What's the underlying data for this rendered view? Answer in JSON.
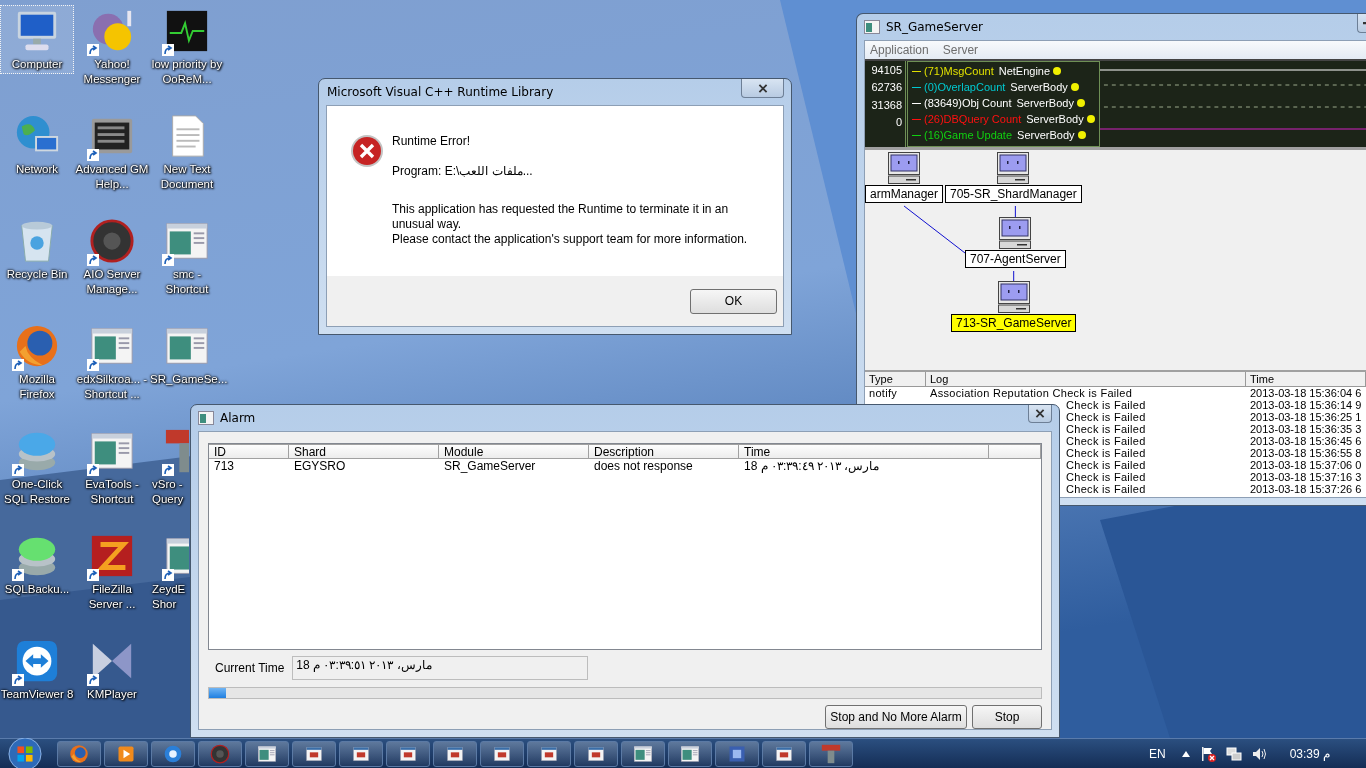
{
  "desktop": {
    "icons": [
      {
        "label": "Computer",
        "kind": "computer",
        "shortcut": false,
        "selected": true
      },
      {
        "label": "Yahoo! Messenger",
        "kind": "messenger",
        "shortcut": true,
        "selected": false
      },
      {
        "label": "low priority by OoReM...",
        "kind": "monitor",
        "shortcut": true,
        "selected": false
      },
      {
        "label": "Network",
        "kind": "network",
        "shortcut": false,
        "selected": false
      },
      {
        "label": "Advanced GM Help...",
        "kind": "terminal",
        "shortcut": true,
        "selected": false
      },
      {
        "label": "New Text Document",
        "kind": "document",
        "shortcut": false,
        "selected": false
      },
      {
        "label": "Recycle Bin",
        "kind": "recycle",
        "shortcut": false,
        "selected": false
      },
      {
        "label": "AIO Server Manage...",
        "kind": "disc",
        "shortcut": true,
        "selected": false
      },
      {
        "label": "smc - Shortcut",
        "kind": "app-window",
        "shortcut": true,
        "selected": false
      },
      {
        "label": "Mozilla Firefox",
        "kind": "browser",
        "shortcut": true,
        "selected": false
      },
      {
        "label": "edxSilkroa... - Shortcut ...",
        "kind": "app-window",
        "shortcut": true,
        "selected": false
      },
      {
        "label": "SR_GameSe...",
        "kind": "app-window",
        "shortcut": false,
        "selected": false
      },
      {
        "label": "One-Click SQL Restore",
        "kind": "database",
        "shortcut": true,
        "selected": false
      },
      {
        "label": "EvaTools - Shortcut",
        "kind": "app-window",
        "shortcut": true,
        "selected": false
      },
      {
        "label": "vSro - Query",
        "kind": "tool",
        "shortcut": true,
        "selected": false
      },
      {
        "label": "SQLBacku...",
        "kind": "backup",
        "shortcut": true,
        "selected": false
      },
      {
        "label": "FileZilla Server ...",
        "kind": "filezilla",
        "shortcut": true,
        "selected": false
      },
      {
        "label": "ZeydE Shor",
        "kind": "app-window",
        "shortcut": true,
        "selected": false
      },
      {
        "label": "TeamViewer 8",
        "kind": "teamviewer",
        "shortcut": true,
        "selected": false
      },
      {
        "label": "KMPlayer",
        "kind": "player",
        "shortcut": true,
        "selected": false
      }
    ]
  },
  "runtime_dialog": {
    "title": "Microsoft Visual C++ Runtime Library",
    "heading": "Runtime Error!",
    "program": "Program: E:\\ملفات اللعب...",
    "message": "This application has requested the Runtime to terminate it in an unusual way.",
    "message_2": "Please contact the application's support team for more information.",
    "button": "OK"
  },
  "sr_window": {
    "title": "SR_GameServer",
    "menu": [
      {
        "label": "Application"
      },
      {
        "label": "Server"
      }
    ],
    "monitor": {
      "axis_labels": [
        "94105",
        "62736",
        "31368",
        "0"
      ],
      "legend": [
        {
          "label": "(71)MsgCount",
          "module": "NetEngine",
          "color": "#e0e000"
        },
        {
          "label": "(0)OverlapCount",
          "module": "ServerBody",
          "color": "#00c8d0"
        },
        {
          "label": "(83649)Obj Count",
          "module": "ServerBody",
          "color": "#ffffff"
        },
        {
          "label": "(26)DBQuery Count",
          "module": "ServerBody",
          "color": "#ff1010"
        },
        {
          "label": "(16)Game Update",
          "module": "ServerBody",
          "color": "#10d010"
        }
      ]
    },
    "diagram": {
      "nodes": [
        {
          "label": "armManager",
          "selected": false
        },
        {
          "label": "705-SR_ShardManager",
          "selected": false
        },
        {
          "label": "707-AgentServer",
          "selected": false
        },
        {
          "label": "713-SR_GameServer",
          "selected": true
        }
      ]
    },
    "log": {
      "columns": [
        "Type",
        "Log",
        "Time"
      ],
      "rows": [
        {
          "type": "notify",
          "log": "Association Reputation Check is Failed",
          "time": "2013-03-18 15:36:04 6"
        },
        {
          "log": "Check is Failed",
          "time": "2013-03-18 15:36:14 9"
        },
        {
          "log": "Check is Failed",
          "time": "2013-03-18 15:36:25 1"
        },
        {
          "log": "Check is Failed",
          "time": "2013-03-18 15:36:35 3"
        },
        {
          "log": "Check is Failed",
          "time": "2013-03-18 15:36:45 6"
        },
        {
          "log": "Check is Failed",
          "time": "2013-03-18 15:36:55 8"
        },
        {
          "log": "Check is Failed",
          "time": "2013-03-18 15:37:06 0"
        },
        {
          "log": "Check is Failed",
          "time": "2013-03-18 15:37:16 3"
        },
        {
          "log": "Check is Failed",
          "time": "2013-03-18 15:37:26 6"
        }
      ]
    }
  },
  "alarm_window": {
    "title": "Alarm",
    "columns": [
      "ID",
      "Shard",
      "Module",
      "Description",
      "Time"
    ],
    "rows": [
      {
        "id": "713",
        "shard": "EGYSRO",
        "module": "SR_GameServer",
        "description": "does not response",
        "time": "18 مارس، ٢٠١٣ ٠٣:٣٩:٤٩ م"
      }
    ],
    "current_time_label": "Current Time",
    "current_time": "18 مارس، ٢٠١٣ ٠٣:٣٩:٥١ م",
    "progress": {
      "level": 0.02
    },
    "buttons": [
      "Stop and No More Alarm",
      "Stop"
    ]
  },
  "taskbar": {
    "items": [
      {
        "kind": "browser"
      },
      {
        "kind": "media"
      },
      {
        "kind": "orb"
      },
      {
        "kind": "disc"
      },
      {
        "kind": "app-window"
      },
      {
        "kind": "app"
      },
      {
        "kind": "app"
      },
      {
        "kind": "app"
      },
      {
        "kind": "app"
      },
      {
        "kind": "app"
      },
      {
        "kind": "app"
      },
      {
        "kind": "app"
      },
      {
        "kind": "app-window"
      },
      {
        "kind": "app-window"
      },
      {
        "kind": "puzzle"
      },
      {
        "kind": "app"
      },
      {
        "kind": "tool"
      }
    ],
    "language": "EN",
    "clock": "03:39 م"
  }
}
